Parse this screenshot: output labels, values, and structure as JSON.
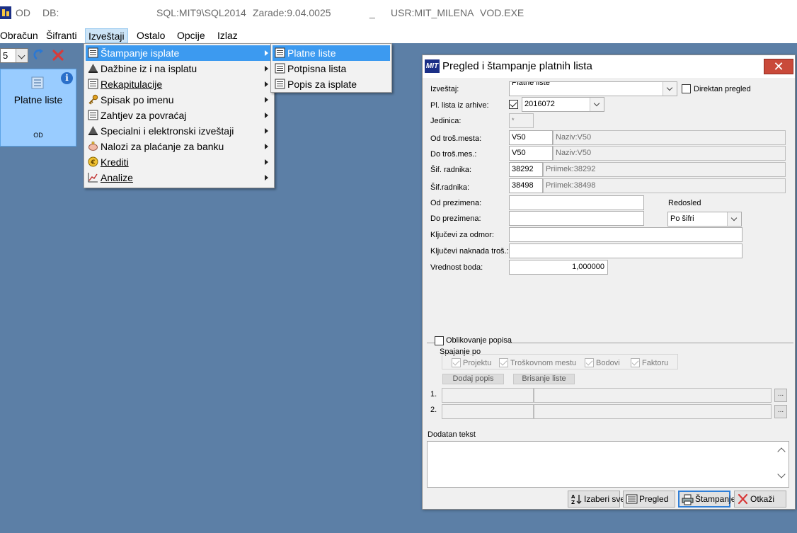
{
  "titlebar": {
    "app": "OD",
    "db_label": "DB:",
    "server": "SQL:MIT9\\SQL2014",
    "version": "Zarade:9.04.0025",
    "separator": "_",
    "user": "USR:MIT_MILENA",
    "exe": "VOD.EXE"
  },
  "menubar": {
    "items": [
      "Obračun",
      "Šifranti",
      "Izveštaji",
      "Ostalo",
      "Opcije",
      "Izlaz"
    ]
  },
  "toolbar": {
    "combo_value": "5"
  },
  "tile": {
    "title": "Platne liste",
    "subtitle": "OD",
    "info": "i"
  },
  "menu": {
    "items": [
      "Štampanje isplate",
      "Dažbine iz i na isplatu",
      "Rekapitulacije",
      "Spisak po imenu",
      "Zahtjev za povraćaj",
      "Specialni i elektronski izveštaji",
      "Nalozi za plaćanje za banku",
      "Krediti",
      "Analize"
    ],
    "submenu": [
      "Platne liste",
      "Potpisna lista",
      "Popis za isplate"
    ]
  },
  "dialog": {
    "logo": "MIT",
    "title": "Pregled i štampanje platnih lista",
    "close": "✕",
    "izvestaj_label": "Izveštaj:",
    "izvestaj_value": "Platne liste",
    "direktan_label": "Direktan pregled",
    "arhiva_label": "Pl. lista iz arhive:",
    "arhiva_value": "2016072",
    "jedinica_label": "Jedinica:",
    "jedinica_value": "*",
    "od_tros_label": "Od troš.mesta:",
    "od_tros_value": "V50",
    "od_tros_naziv": "Naziv:V50",
    "do_tros_label": "Do troš.mes.:",
    "do_tros_value": "V50",
    "do_tros_naziv": "Naziv:V50",
    "sif_od_label": "Šif. radnika:",
    "sif_od_value": "38292",
    "sif_od_prezime": "Priimek:38292",
    "sif_do_label": "Šif.radnika:",
    "sif_do_value": "38498",
    "sif_do_prezime": "Priimek:38498",
    "od_prez_label": "Od prezimena:",
    "do_prez_label": "Do prezimena:",
    "redosled_label": "Redosled",
    "redosled_value": "Po šifri",
    "kljucevi_odmor_label": "Ključevi za odmor:",
    "kljucevi_nak_label": "Ključevi naknada troš.:",
    "vrednost_label": "Vrednost boda:",
    "vrednost_value": "1,000000",
    "oblikovanje_label": "Oblikovanje popisa",
    "spajanje_label": "Spajanje po",
    "spajanje_opts": [
      "Projektu",
      "Troškovnom mestu",
      "Bodovi",
      "Faktoru"
    ],
    "dodaj_label": "Dodaj popis",
    "brisanje_label": "Brisanje liste",
    "row1_label": "1.",
    "row2_label": "2.",
    "ellipsis": "...",
    "dodatan_label": "Dodatan tekst",
    "buttons": [
      "Izaberi sve",
      "Pregled",
      "Štampanje",
      "Otkaži"
    ]
  }
}
